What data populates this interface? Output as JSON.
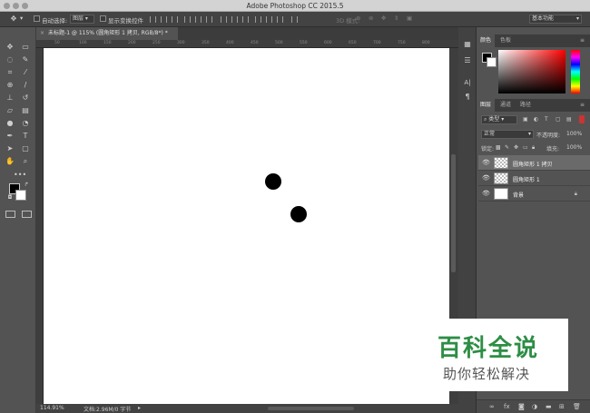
{
  "app": {
    "title": "Adobe Photoshop CC 2015.5"
  },
  "options_bar": {
    "auto_select_label": "自动选择:",
    "auto_select_value": "图层",
    "show_transform_label": "显示变换控件",
    "mode_3d_label": "3D 模式:",
    "workspace": "基本功能"
  },
  "toolbar": {
    "tools": [
      {
        "icon": "move-icon",
        "glyph": "✥"
      },
      {
        "icon": "artboard-icon",
        "glyph": "▭"
      },
      {
        "icon": "lasso-icon",
        "glyph": "◌"
      },
      {
        "icon": "quick-select-icon",
        "glyph": "✎"
      },
      {
        "icon": "crop-icon",
        "glyph": "⌗"
      },
      {
        "icon": "eyedropper-icon",
        "glyph": "⁄"
      },
      {
        "icon": "healing-brush-icon",
        "glyph": "⊕"
      },
      {
        "icon": "brush-icon",
        "glyph": "/"
      },
      {
        "icon": "stamp-icon",
        "glyph": "⊥"
      },
      {
        "icon": "history-brush-icon",
        "glyph": "↺"
      },
      {
        "icon": "eraser-icon",
        "glyph": "▱"
      },
      {
        "icon": "gradient-icon",
        "glyph": "▤"
      },
      {
        "icon": "blur-icon",
        "glyph": "●"
      },
      {
        "icon": "dodge-icon",
        "glyph": "◔"
      },
      {
        "icon": "pen-icon",
        "glyph": "✒"
      },
      {
        "icon": "type-icon",
        "glyph": "T"
      },
      {
        "icon": "path-select-icon",
        "glyph": "➤"
      },
      {
        "icon": "shape-icon",
        "glyph": "▢"
      },
      {
        "icon": "hand-icon",
        "glyph": "✋"
      },
      {
        "icon": "zoom-icon",
        "glyph": "⌕"
      }
    ]
  },
  "document": {
    "tab_label": "未标题-1 @ 115% (圆角矩形 1 拷贝, RGB/8*) *",
    "ruler_ticks": [
      "50",
      "100",
      "150",
      "200",
      "250",
      "300",
      "350",
      "400",
      "450",
      "500",
      "550",
      "600",
      "650",
      "700",
      "750",
      "800"
    ]
  },
  "status": {
    "zoom": "114.91%",
    "doc_size": "文档:2.96M/0 字节"
  },
  "color_panel": {
    "tabs": [
      "颜色",
      "色板"
    ],
    "foreground": "#000000",
    "background": "#ffffff"
  },
  "layers_panel": {
    "tabs": [
      "图层",
      "通道",
      "路径"
    ],
    "filter_label": "类型",
    "blend_mode": "正常",
    "opacity_label": "不透明度:",
    "opacity_value": "100%",
    "lock_label": "锁定:",
    "fill_label": "填充:",
    "fill_value": "100%",
    "layers": [
      {
        "name": "圆角矩形 1 拷贝",
        "selected": true
      },
      {
        "name": "圆角矩形 1",
        "selected": false
      },
      {
        "name": "背景",
        "selected": false
      }
    ]
  },
  "watermark": {
    "title": "百科全说",
    "subtitle": "助你轻松解决"
  }
}
